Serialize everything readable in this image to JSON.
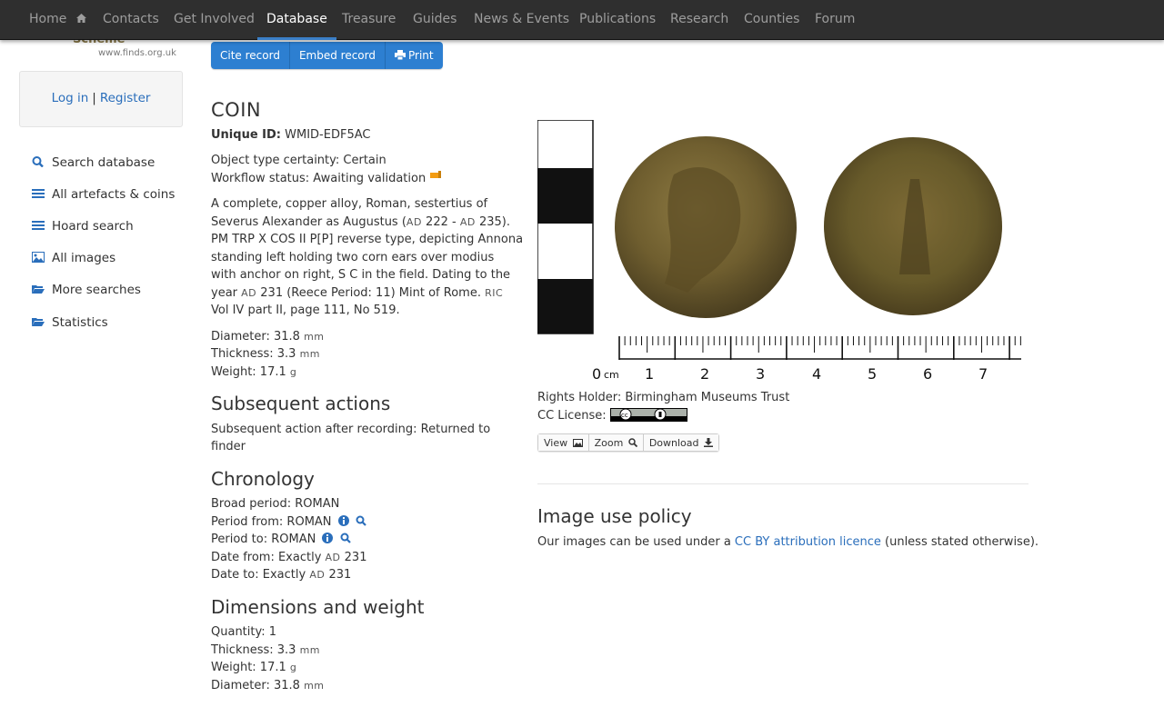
{
  "nav": {
    "items": [
      "Home",
      "Contacts",
      "Get Involved",
      "Database",
      "Treasure",
      "Guides",
      "News & Events",
      "Publications",
      "Research",
      "Counties",
      "Forum"
    ],
    "active": "Database"
  },
  "logo": {
    "url_text": "www.finds.org.uk",
    "fragment": "Scheme"
  },
  "auth": {
    "login": "Log in",
    "separator": "|",
    "register": "Register"
  },
  "sidebar": {
    "links": [
      "Search database",
      "All artefacts & coins",
      "Hoard search",
      "All images",
      "More searches",
      "Statistics"
    ]
  },
  "actions": {
    "cite": "Cite record",
    "embed": "Embed record",
    "print": "Print"
  },
  "record": {
    "title": "COIN",
    "unique_id_label": "Unique ID:",
    "unique_id": "WMID-EDF5AC",
    "certainty": "Object type certainty: Certain",
    "workflow": "Workflow status: Awaiting validation",
    "description": {
      "l1": "A complete, copper alloy, Roman, sestertius of",
      "l2a": "Severus Alexander as Augustus (",
      "ad": "AD",
      "l2b": " 222 - ",
      "l2c": " 235).",
      "l3": "PM TRP X COS II P[P] reverse type, depicting Annona",
      "l4": "standing left holding two corn ears over modius",
      "l5": "with anchor on right, S C in the field. Dating to the",
      "l6a": "year ",
      "l6b": " 231 (Reece Period: 11) Mint of Rome. ",
      "ric": "RIC",
      "l7": "Vol IV part II, page 111, No 519."
    },
    "measures": {
      "diameter_label": "Diameter: 31.8",
      "thickness_label": "Thickness: 3.3",
      "weight_label": "Weight: 17.1",
      "mm": "mm",
      "g": "g"
    }
  },
  "subsequent": {
    "heading": "Subsequent actions",
    "l1": "Subsequent action after recording: Returned to",
    "l2": "finder"
  },
  "chronology": {
    "heading": "Chronology",
    "broad": "Broad period: ROMAN",
    "from": "Period from: ROMAN",
    "to": "Period to: ROMAN",
    "date_from_a": "Date from: Exactly ",
    "date_to_a": "Date to: Exactly ",
    "ad": "AD",
    "year": " 231"
  },
  "dimensions": {
    "heading": "Dimensions and weight",
    "quantity": "Quantity: 1",
    "thickness": "Thickness: 3.3",
    "weight": "Weight: 17.1",
    "diameter": "Diameter: 31.8",
    "mm": "mm",
    "g": "g"
  },
  "image": {
    "scale_labels": [
      "0",
      "cm",
      "1",
      "2",
      "3",
      "4",
      "5",
      "6",
      "7"
    ],
    "rights": "Rights Holder: Birmingham Museums Trust",
    "cc_label": "CC License:",
    "view": "View",
    "zoom": "Zoom",
    "download": "Download"
  },
  "policy": {
    "heading": "Image use policy",
    "before": "Our images can be used under a ",
    "link": "CC BY attribution licence",
    "after": " (unless stated otherwise)."
  },
  "colors": {
    "nav_bg": "#2f2f2f",
    "accent": "#2d7fd1",
    "link": "#2a6ebb"
  }
}
